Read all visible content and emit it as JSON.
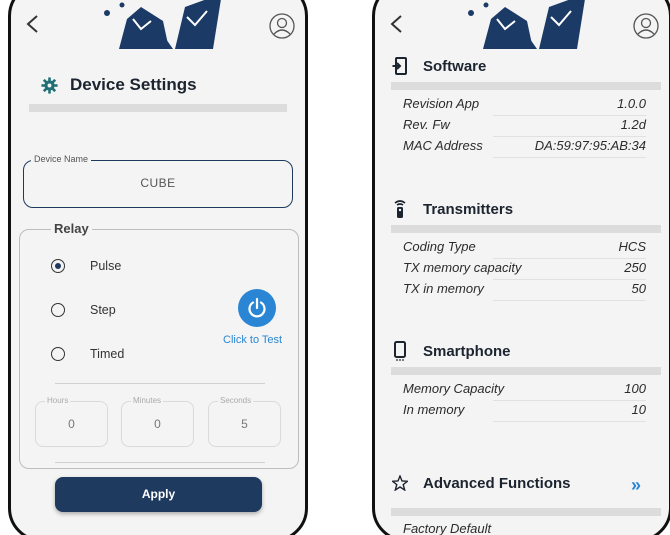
{
  "left": {
    "title": "Device Settings",
    "device_name": {
      "label": "Device Name",
      "value": "CUBE"
    },
    "relay": {
      "label": "Relay",
      "options": [
        {
          "label": "Pulse",
          "checked": true
        },
        {
          "label": "Step",
          "checked": false
        },
        {
          "label": "Timed",
          "checked": false
        }
      ],
      "test_label": "Click to Test",
      "time": [
        {
          "label": "Hours",
          "value": "0"
        },
        {
          "label": "Minutes",
          "value": "0"
        },
        {
          "label": "Seconds",
          "value": "5"
        }
      ]
    },
    "apply_label": "Apply"
  },
  "right": {
    "software": {
      "title": "Software",
      "rows": [
        {
          "key": "Revision App",
          "value": "1.0.0"
        },
        {
          "key": "Rev. Fw",
          "value": "1.2d"
        },
        {
          "key": "MAC Address",
          "value": "DA:59:97:95:AB:34"
        }
      ]
    },
    "transmitters": {
      "title": "Transmitters",
      "rows": [
        {
          "key": "Coding Type",
          "value": "HCS"
        },
        {
          "key": "TX memory capacity",
          "value": "250"
        },
        {
          "key": "TX in memory",
          "value": "50"
        }
      ]
    },
    "smartphone": {
      "title": "Smartphone",
      "rows": [
        {
          "key": "Memory Capacity",
          "value": "100"
        },
        {
          "key": "In memory",
          "value": "10"
        }
      ]
    },
    "advanced": {
      "title": "Advanced Functions",
      "chevron": "»"
    },
    "factory_default": "Factory Default"
  },
  "icons": {
    "back": "back-arrow-icon",
    "avatar": "user-avatar-icon",
    "gear": "gear-icon",
    "software": "software-icon",
    "transmitter": "remote-transmitter-icon",
    "smartphone": "smartphone-icon",
    "star": "star-icon",
    "power": "power-icon"
  },
  "colors": {
    "primary_dark": "#1e3a5f",
    "accent_blue": "#2a86d4",
    "background": "#f4f4f4",
    "logo_navy": "#1b3a66"
  }
}
